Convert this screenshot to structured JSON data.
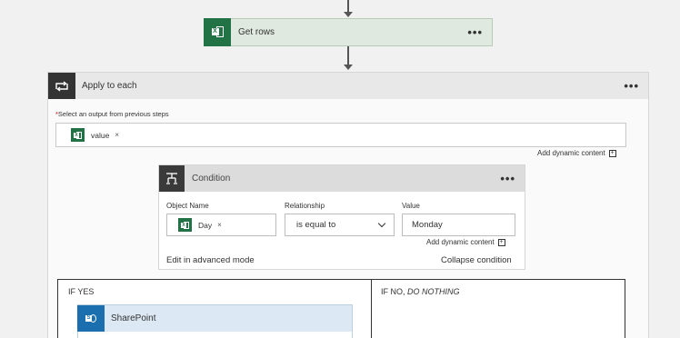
{
  "get_rows": {
    "title": "Get rows",
    "menu": "•••"
  },
  "apply_to_each": {
    "title": "Apply to each",
    "menu": "•••",
    "required_mark": "*",
    "select_label": "Select an output from previous steps",
    "token": {
      "label": "value",
      "remove": "×"
    },
    "add_dynamic": "Add dynamic content",
    "add_dynamic_icon": "+"
  },
  "condition": {
    "title": "Condition",
    "menu": "•••",
    "object_name_label": "Object Name",
    "relationship_label": "Relationship",
    "value_label": "Value",
    "object_token": {
      "label": "Day",
      "remove": "×"
    },
    "relationship_value": "is equal to",
    "value_value": "Monday",
    "add_dynamic": "Add dynamic content",
    "add_dynamic_icon": "+",
    "edit_advanced": "Edit in advanced mode",
    "collapse": "Collapse condition"
  },
  "branches": {
    "if_yes": "IF YES",
    "if_no_prefix": "IF NO, ",
    "if_no_em": "DO NOTHING",
    "sharepoint_title": "SharePoint"
  },
  "colors": {
    "excel": "#217346",
    "sharepoint": "#1b6fae",
    "getrows_bg": "#dfe9df",
    "required": "#cc0000"
  }
}
